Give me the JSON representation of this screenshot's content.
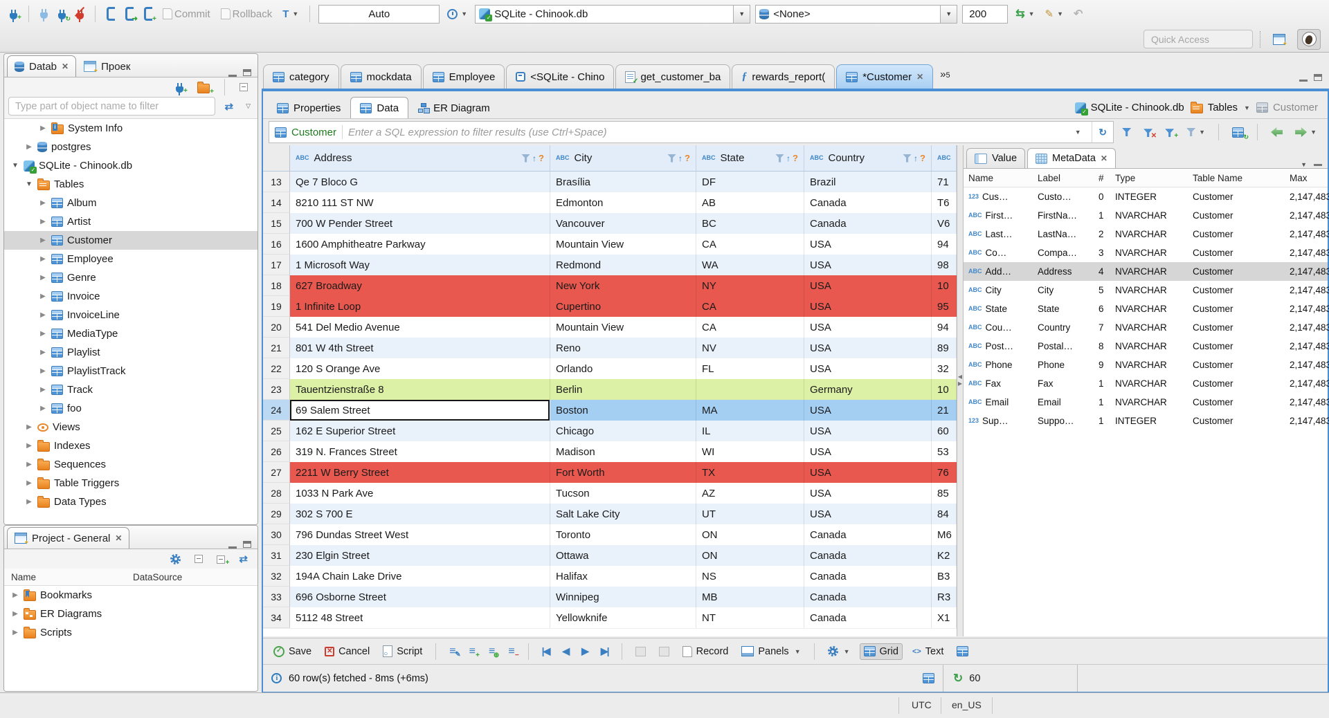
{
  "toolbar": {
    "commit_label": "Commit",
    "rollback_label": "Rollback",
    "txn_mode": "Auto",
    "connection": "SQLite - Chinook.db",
    "schema": "<None>",
    "fetch_size": "200",
    "quick_access_placeholder": "Quick Access"
  },
  "left": {
    "nav_tab": "Datab",
    "projects_tab": "Проек",
    "filter_placeholder": "Type part of object name to filter",
    "tree": [
      {
        "label": "System Info",
        "icon": "folder-info",
        "depth": 2,
        "state": "collapsed"
      },
      {
        "label": "postgres",
        "icon": "db",
        "depth": 1,
        "state": "collapsed"
      },
      {
        "label": "SQLite - Chinook.db",
        "icon": "sqlite",
        "depth": 0,
        "state": "expanded"
      },
      {
        "label": "Tables",
        "icon": "folder-table",
        "depth": 1,
        "state": "expanded"
      },
      {
        "label": "Album",
        "icon": "table",
        "depth": 2,
        "state": "collapsed"
      },
      {
        "label": "Artist",
        "icon": "table",
        "depth": 2,
        "state": "collapsed"
      },
      {
        "label": "Customer",
        "icon": "table",
        "depth": 2,
        "state": "collapsed",
        "selected": true
      },
      {
        "label": "Employee",
        "icon": "table",
        "depth": 2,
        "state": "collapsed"
      },
      {
        "label": "Genre",
        "icon": "table",
        "depth": 2,
        "state": "collapsed"
      },
      {
        "label": "Invoice",
        "icon": "table",
        "depth": 2,
        "state": "collapsed"
      },
      {
        "label": "InvoiceLine",
        "icon": "table",
        "depth": 2,
        "state": "collapsed"
      },
      {
        "label": "MediaType",
        "icon": "table",
        "depth": 2,
        "state": "collapsed"
      },
      {
        "label": "Playlist",
        "icon": "table",
        "depth": 2,
        "state": "collapsed"
      },
      {
        "label": "PlaylistTrack",
        "icon": "table",
        "depth": 2,
        "state": "collapsed"
      },
      {
        "label": "Track",
        "icon": "table",
        "depth": 2,
        "state": "collapsed"
      },
      {
        "label": "foo",
        "icon": "table",
        "depth": 2,
        "state": "collapsed"
      },
      {
        "label": "Views",
        "icon": "eye",
        "depth": 1,
        "state": "collapsed"
      },
      {
        "label": "Indexes",
        "icon": "folder",
        "depth": 1,
        "state": "collapsed"
      },
      {
        "label": "Sequences",
        "icon": "folder",
        "depth": 1,
        "state": "collapsed"
      },
      {
        "label": "Table Triggers",
        "icon": "folder",
        "depth": 1,
        "state": "collapsed"
      },
      {
        "label": "Data Types",
        "icon": "folder",
        "depth": 1,
        "state": "collapsed"
      }
    ],
    "project_panel": {
      "title": "Project - General",
      "columns": [
        "Name",
        "DataSource"
      ],
      "items": [
        {
          "label": "Bookmarks",
          "icon": "folder-bm"
        },
        {
          "label": "ER Diagrams",
          "icon": "folder-er"
        },
        {
          "label": "Scripts",
          "icon": "folder"
        }
      ]
    }
  },
  "editor": {
    "tabs": [
      {
        "label": "category",
        "icon": "table"
      },
      {
        "label": "mockdata",
        "icon": "table"
      },
      {
        "label": "Employee",
        "icon": "table"
      },
      {
        "label": "<SQLite - Chino",
        "icon": "console"
      },
      {
        "label": "get_customer_ba",
        "icon": "script"
      },
      {
        "label": "rewards_report(",
        "icon": "function"
      },
      {
        "label": "*Customer",
        "icon": "table",
        "active": true,
        "closable": true
      }
    ],
    "hidden_tabs_count": "5",
    "subtabs": [
      {
        "label": "Properties",
        "icon": "table"
      },
      {
        "label": "Data",
        "icon": "table",
        "active": true
      },
      {
        "label": "ER Diagram",
        "icon": "diagram"
      }
    ],
    "breadcrumb": {
      "connection": "SQLite - Chinook.db",
      "container": "Tables",
      "object": "Customer"
    }
  },
  "filter": {
    "table": "Customer",
    "placeholder": "Enter a SQL expression to filter results (use Ctrl+Space)"
  },
  "grid": {
    "columns": [
      {
        "name": "Address",
        "kind": "ABC"
      },
      {
        "name": "City",
        "kind": "ABC"
      },
      {
        "name": "State",
        "kind": "ABC"
      },
      {
        "name": "Country",
        "kind": "ABC"
      },
      {
        "name": "",
        "kind": "ABC"
      }
    ],
    "rows": [
      {
        "num": "13",
        "cells": [
          "Qe 7 Bloco G",
          "Brasília",
          "DF",
          "Brazil",
          "71"
        ]
      },
      {
        "num": "14",
        "cells": [
          "8210 111 ST NW",
          "Edmonton",
          "AB",
          "Canada",
          "T6"
        ]
      },
      {
        "num": "15",
        "cells": [
          "700 W Pender Street",
          "Vancouver",
          "BC",
          "Canada",
          "V6"
        ]
      },
      {
        "num": "16",
        "cells": [
          "1600 Amphitheatre Parkway",
          "Mountain View",
          "CA",
          "USA",
          "94"
        ]
      },
      {
        "num": "17",
        "cells": [
          "1 Microsoft Way",
          "Redmond",
          "WA",
          "USA",
          "98"
        ]
      },
      {
        "num": "18",
        "cells": [
          "627 Broadway",
          "New York",
          "NY",
          "USA",
          "10"
        ],
        "highlight": "red"
      },
      {
        "num": "19",
        "cells": [
          "1 Infinite Loop",
          "Cupertino",
          "CA",
          "USA",
          "95"
        ],
        "highlight": "red"
      },
      {
        "num": "20",
        "cells": [
          "541 Del Medio Avenue",
          "Mountain View",
          "CA",
          "USA",
          "94"
        ]
      },
      {
        "num": "21",
        "cells": [
          "801 W 4th Street",
          "Reno",
          "NV",
          "USA",
          "89"
        ]
      },
      {
        "num": "22",
        "cells": [
          "120 S Orange Ave",
          "Orlando",
          "FL",
          "USA",
          "32"
        ]
      },
      {
        "num": "23",
        "cells": [
          "Tauentzienstraße 8",
          "Berlin",
          "",
          "Germany",
          "10"
        ],
        "highlight": "green"
      },
      {
        "num": "24",
        "cells": [
          "69 Salem Street",
          "Boston",
          "MA",
          "USA",
          "21"
        ],
        "highlight": "selected",
        "focus_cell": 0
      },
      {
        "num": "25",
        "cells": [
          "162 E Superior Street",
          "Chicago",
          "IL",
          "USA",
          "60"
        ]
      },
      {
        "num": "26",
        "cells": [
          "319 N. Frances Street",
          "Madison",
          "WI",
          "USA",
          "53"
        ]
      },
      {
        "num": "27",
        "cells": [
          "2211 W Berry Street",
          "Fort Worth",
          "TX",
          "USA",
          "76"
        ],
        "highlight": "red"
      },
      {
        "num": "28",
        "cells": [
          "1033 N Park Ave",
          "Tucson",
          "AZ",
          "USA",
          "85"
        ]
      },
      {
        "num": "29",
        "cells": [
          "302 S 700 E",
          "Salt Lake City",
          "UT",
          "USA",
          "84"
        ]
      },
      {
        "num": "30",
        "cells": [
          "796 Dundas Street West",
          "Toronto",
          "ON",
          "Canada",
          "M6"
        ]
      },
      {
        "num": "31",
        "cells": [
          "230 Elgin Street",
          "Ottawa",
          "ON",
          "Canada",
          "K2"
        ]
      },
      {
        "num": "32",
        "cells": [
          "194A Chain Lake Drive",
          "Halifax",
          "NS",
          "Canada",
          "B3"
        ]
      },
      {
        "num": "33",
        "cells": [
          "696 Osborne Street",
          "Winnipeg",
          "MB",
          "Canada",
          "R3"
        ]
      },
      {
        "num": "34",
        "cells": [
          "5112 48 Street",
          "Yellowknife",
          "NT",
          "Canada",
          "X1"
        ]
      }
    ]
  },
  "panel": {
    "value_tab": "Value",
    "meta_tab": "MetaData",
    "columns": [
      "Name",
      "Label",
      "#",
      "Type",
      "Table Name",
      "Max "
    ],
    "rows": [
      {
        "kind": "123",
        "name": "Cus…",
        "label": "Custo…",
        "num": "0",
        "type": "INTEGER",
        "table": "Customer",
        "max": "2,147,483"
      },
      {
        "kind": "ABC",
        "name": "First…",
        "label": "FirstNa…",
        "num": "1",
        "type": "NVARCHAR",
        "table": "Customer",
        "max": "2,147,483"
      },
      {
        "kind": "ABC",
        "name": "Last…",
        "label": "LastNa…",
        "num": "2",
        "type": "NVARCHAR",
        "table": "Customer",
        "max": "2,147,483"
      },
      {
        "kind": "ABC",
        "name": "Co…",
        "label": "Compa…",
        "num": "3",
        "type": "NVARCHAR",
        "table": "Customer",
        "max": "2,147,483"
      },
      {
        "kind": "ABC",
        "name": "Add…",
        "label": "Address",
        "num": "4",
        "type": "NVARCHAR",
        "table": "Customer",
        "max": "2,147,483",
        "selected": true
      },
      {
        "kind": "ABC",
        "name": "City",
        "label": "City",
        "num": "5",
        "type": "NVARCHAR",
        "table": "Customer",
        "max": "2,147,483"
      },
      {
        "kind": "ABC",
        "name": "State",
        "label": "State",
        "num": "6",
        "type": "NVARCHAR",
        "table": "Customer",
        "max": "2,147,483"
      },
      {
        "kind": "ABC",
        "name": "Cou…",
        "label": "Country",
        "num": "7",
        "type": "NVARCHAR",
        "table": "Customer",
        "max": "2,147,483"
      },
      {
        "kind": "ABC",
        "name": "Post…",
        "label": "Postal…",
        "num": "8",
        "type": "NVARCHAR",
        "table": "Customer",
        "max": "2,147,483"
      },
      {
        "kind": "ABC",
        "name": "Phone",
        "label": "Phone",
        "num": "9",
        "type": "NVARCHAR",
        "table": "Customer",
        "max": "2,147,483"
      },
      {
        "kind": "ABC",
        "name": "Fax",
        "label": "Fax",
        "num": "1",
        "type": "NVARCHAR",
        "table": "Customer",
        "max": "2,147,483"
      },
      {
        "kind": "ABC",
        "name": "Email",
        "label": "Email",
        "num": "1",
        "type": "NVARCHAR",
        "table": "Customer",
        "max": "2,147,483"
      },
      {
        "kind": "123",
        "name": "Sup…",
        "label": "Suppo…",
        "num": "1",
        "type": "INTEGER",
        "table": "Customer",
        "max": "2,147,483"
      }
    ]
  },
  "rtoolbar": {
    "save": "Save",
    "cancel": "Cancel",
    "script": "Script",
    "record": "Record",
    "panels": "Panels",
    "grid": "Grid",
    "text": "Text"
  },
  "status": {
    "message": "60 row(s) fetched - 8ms (+6ms)",
    "fetch_count": "60"
  },
  "statusbar": {
    "timezone": "UTC",
    "locale": "en_US"
  }
}
